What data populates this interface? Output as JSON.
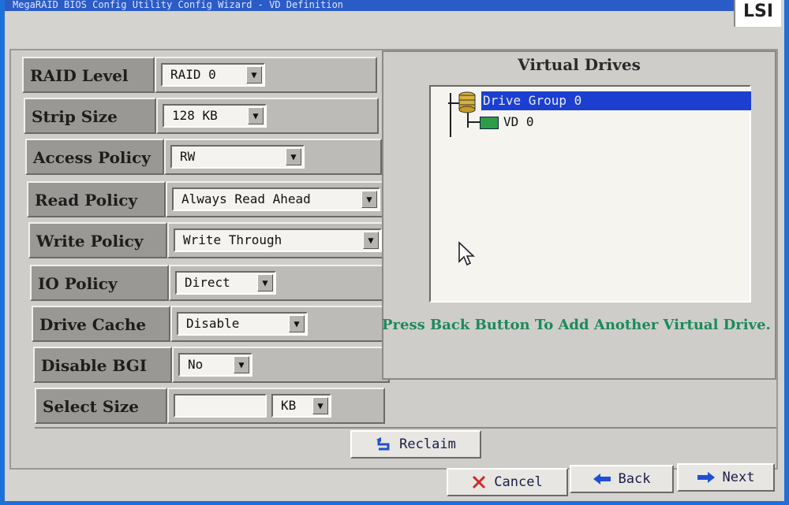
{
  "window": {
    "title": "MegaRAID BIOS Config Utility  Config Wizard - VD Definition",
    "logo_text": "LSI"
  },
  "properties": [
    {
      "label": "RAID Level",
      "value": "RAID 0"
    },
    {
      "label": "Strip Size",
      "value": "128 KB"
    },
    {
      "label": "Access Policy",
      "value": "RW"
    },
    {
      "label": "Read Policy",
      "value": "Always Read Ahead"
    },
    {
      "label": "Write Policy",
      "value": "Write Through"
    },
    {
      "label": "IO Policy",
      "value": "Direct"
    },
    {
      "label": "Drive Cache",
      "value": "Disable"
    },
    {
      "label": "Disable BGI",
      "value": "No"
    },
    {
      "label": "Select Size",
      "value": "",
      "unit": "KB"
    }
  ],
  "virtual_drives": {
    "title": "Virtual Drives",
    "drive_group": "Drive Group 0",
    "vd": "VD 0"
  },
  "info_message": "Press Back Button To Add Another Virtual Drive.",
  "buttons": {
    "reclaim": "Reclaim",
    "cancel": "Cancel",
    "back": "Back",
    "next": "Next"
  },
  "colors": {
    "selection": "#1d3fd0",
    "info_text": "#1c8a58",
    "cancel_icon": "#d02a2a",
    "nav_icon": "#1f4fd6"
  }
}
